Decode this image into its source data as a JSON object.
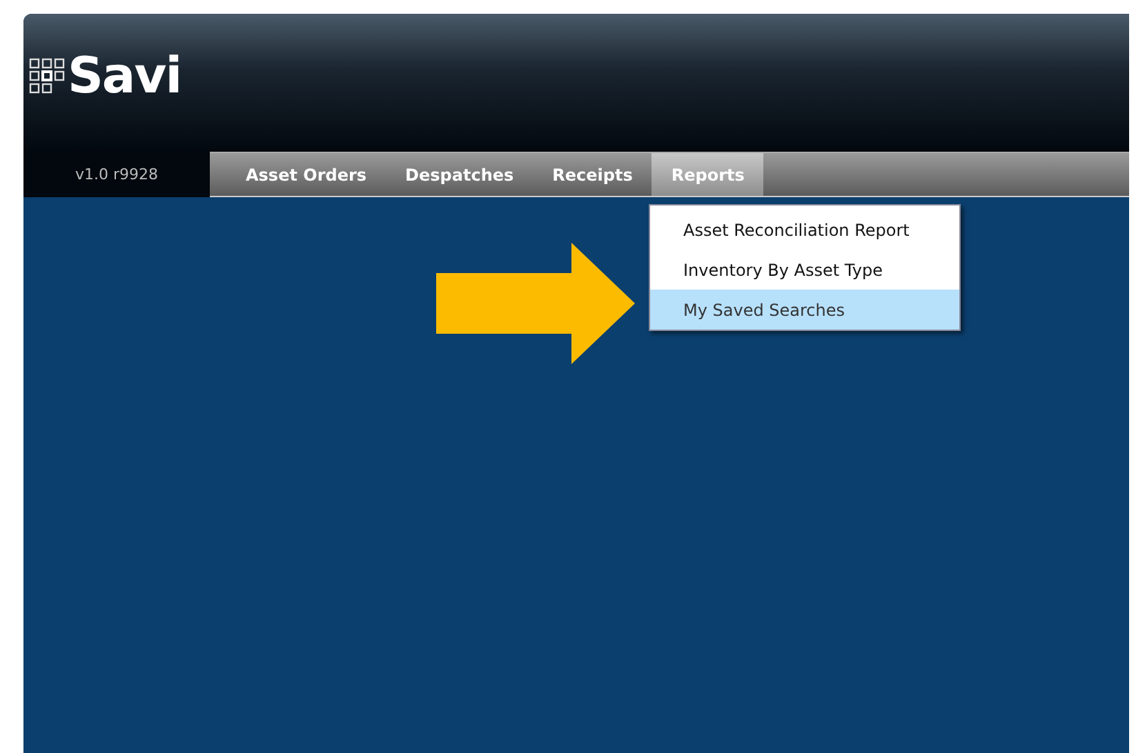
{
  "logo": {
    "text": "Savi"
  },
  "version": "v1.0 r9928",
  "nav": [
    {
      "label": "Asset Orders",
      "selected": false
    },
    {
      "label": "Despatches",
      "selected": false
    },
    {
      "label": "Receipts",
      "selected": false
    },
    {
      "label": "Reports",
      "selected": true
    }
  ],
  "dropdown": {
    "items": [
      {
        "label": "Asset Reconciliation Report",
        "selected": false
      },
      {
        "label": "Inventory By Asset Type",
        "selected": false
      },
      {
        "label": "My Saved Searches",
        "selected": true
      }
    ]
  }
}
